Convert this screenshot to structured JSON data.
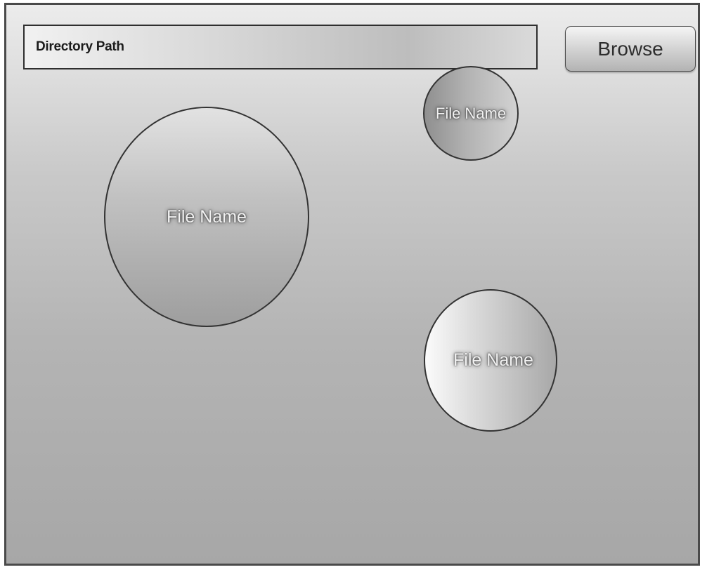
{
  "directory": {
    "label": "Directory Path"
  },
  "browse": {
    "label": "Browse"
  },
  "files": [
    {
      "label": "File Name"
    },
    {
      "label": "File Name"
    },
    {
      "label": "File Name"
    }
  ]
}
